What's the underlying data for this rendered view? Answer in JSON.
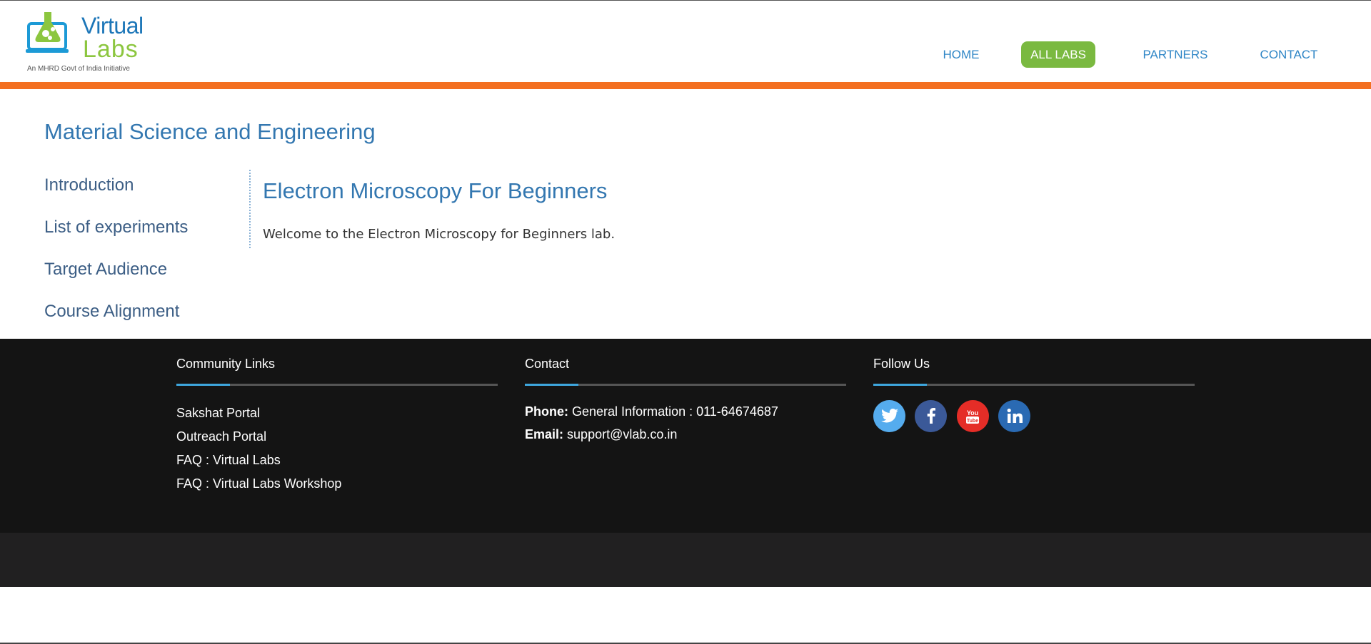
{
  "header": {
    "logo": {
      "word1": "Virtual",
      "word2": "Labs",
      "tagline": "An MHRD Govt of India Initiative"
    },
    "nav": [
      {
        "label": "HOME",
        "active": false
      },
      {
        "label": "ALL LABS",
        "active": true
      },
      {
        "label": "PARTNERS",
        "active": false
      },
      {
        "label": "CONTACT",
        "active": false
      }
    ]
  },
  "colors": {
    "accent_orange": "#f36f21",
    "accent_green": "#7ab940",
    "link_blue": "#3377b0",
    "footer_bg": "#141414",
    "footer_rule_accent": "#3ea6dd"
  },
  "main": {
    "page_title": "Material Science and Engineering",
    "side_nav": [
      {
        "label": "Introduction"
      },
      {
        "label": "List of experiments"
      },
      {
        "label": "Target Audience"
      },
      {
        "label": "Course Alignment"
      }
    ],
    "content": {
      "heading": "Electron Microscopy For Beginners",
      "text": "Welcome to the Electron Microscopy for Beginners lab."
    }
  },
  "footer": {
    "community": {
      "title": "Community Links",
      "links": [
        {
          "label": "Sakshat Portal"
        },
        {
          "label": "Outreach Portal"
        },
        {
          "label": "FAQ : Virtual Labs"
        },
        {
          "label": "FAQ : Virtual Labs Workshop"
        }
      ]
    },
    "contact": {
      "title": "Contact",
      "phone_label": "Phone:",
      "phone_value": "General Information : 011-64674687",
      "email_label": "Email:",
      "email_value": "support@vlab.co.in"
    },
    "follow": {
      "title": "Follow Us",
      "icons": [
        {
          "name": "twitter-icon",
          "color": "#55acee"
        },
        {
          "name": "facebook-icon",
          "color": "#3b5998"
        },
        {
          "name": "youtube-icon",
          "color": "#e52d27"
        },
        {
          "name": "linkedin-icon",
          "color": "#2a6ab3"
        }
      ]
    }
  }
}
